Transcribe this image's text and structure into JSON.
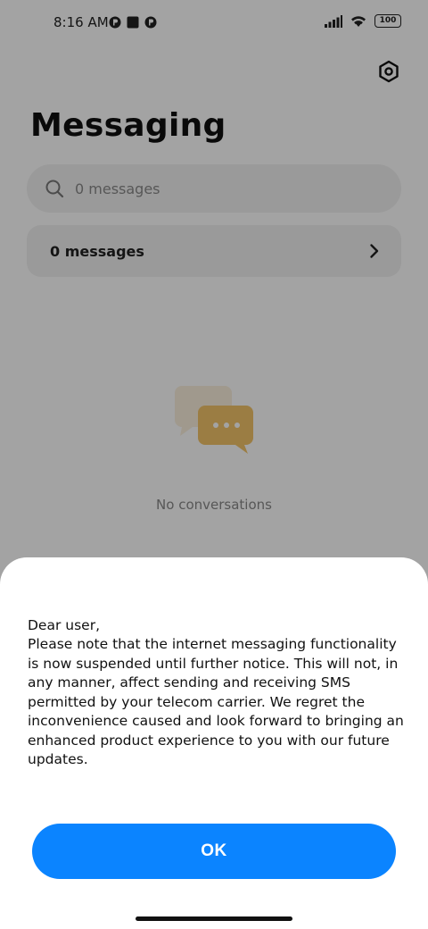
{
  "status_bar": {
    "time": "8:16 AM",
    "battery": "100"
  },
  "header": {
    "title": "Messaging",
    "settings_icon": "gear-icon"
  },
  "search": {
    "placeholder": "0 messages",
    "icon": "search-icon"
  },
  "summary_row": {
    "label": "0 messages",
    "icon": "chevron-right-icon"
  },
  "empty_state": {
    "text": "No conversations",
    "icon": "chat-bubbles-icon",
    "accent": "#f2c46a"
  },
  "dialog": {
    "greeting": "Dear user,",
    "message": "Please note that the internet messaging functionality is now suspended until further notice. This will not, in any manner, affect sending and receiving SMS permitted by your telecom carrier. We regret the inconvenience caused and look forward to bringing an enhanced product experience to you with our future updates.",
    "ok_label": "OK",
    "button_color": "#0b84ff"
  }
}
